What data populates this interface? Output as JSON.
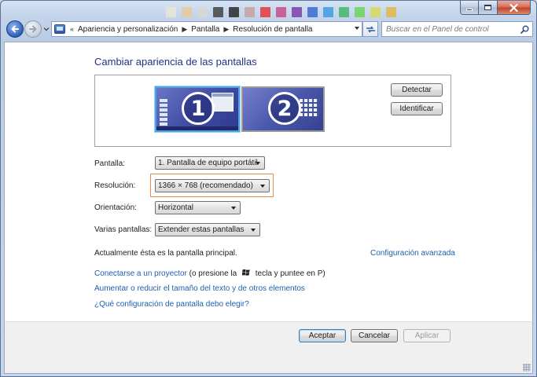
{
  "window": {
    "controls": {
      "minimize": "minimize",
      "maximize": "maximize",
      "close": "close"
    },
    "deco_colors": [
      "#e9e6d6",
      "#e7c99b",
      "#d7d8d6",
      "#444444",
      "#2c2c2c",
      "#c9a0a0",
      "#e23a3a",
      "#c94c8a",
      "#7b3fa8",
      "#3c6bd0",
      "#3f9be0",
      "#42b96b",
      "#6fd35a",
      "#d8d85a",
      "#e0b84c"
    ]
  },
  "nav": {
    "breadcrumbs": [
      "Apariencia y personalización",
      "Pantalla",
      "Resolución de pantalla"
    ],
    "overflow": "«",
    "search_placeholder": "Buscar en el Panel de control"
  },
  "main": {
    "title": "Cambiar apariencia de las pantallas",
    "monitors": [
      {
        "number": "1",
        "selected": true
      },
      {
        "number": "2",
        "selected": false
      }
    ],
    "detect_button": "Detectar",
    "identify_button": "Identificar",
    "fields": {
      "display": {
        "label": "Pantalla:",
        "value": "1. Pantalla de equipo portátil"
      },
      "resolution": {
        "label": "Resolución:",
        "value": "1366 × 768 (recomendado)"
      },
      "orientation": {
        "label": "Orientación:",
        "value": "Horizontal"
      },
      "multiple": {
        "label": "Varias pantallas:",
        "value": "Extender estas pantallas"
      }
    },
    "primary_note": "Actualmente ésta es la pantalla principal.",
    "advanced_link": "Configuración avanzada",
    "projector_link": "Conectarse a un proyector",
    "projector_note_before": "(o presione la",
    "projector_note_after": "tecla y puntee en P)",
    "text_size_link": "Aumentar o reducir el tamaño del texto y de otros elementos",
    "which_settings_link": "¿Qué configuración de pantalla debo elegir?"
  },
  "footer": {
    "accept": "Aceptar",
    "cancel": "Cancelar",
    "apply": "Aplicar"
  }
}
